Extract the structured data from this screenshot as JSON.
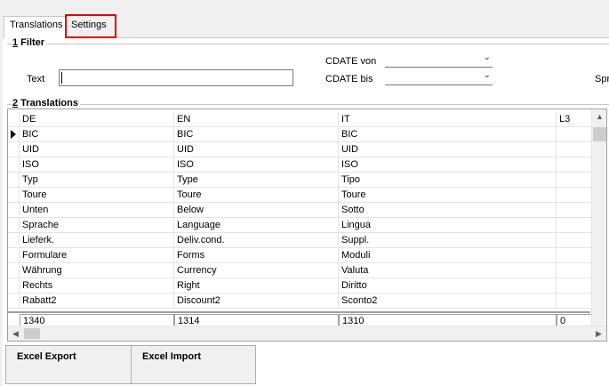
{
  "tabs": {
    "translations": "Translations",
    "settings": "Settings"
  },
  "filter": {
    "title_num": "1",
    "title_text": " Filter",
    "text_label": "Text",
    "text_value": "",
    "cdate_von_label": "CDATE von",
    "cdate_bis_label": "CDATE bis",
    "cdate_von_value": "",
    "cdate_bis_value": "",
    "spr_label": "Spr"
  },
  "translations": {
    "title_num": "2",
    "title_text": " Translations",
    "columns": [
      "DE",
      "EN",
      "IT",
      "L3"
    ],
    "rows": [
      [
        "BIC",
        "BIC",
        "BIC",
        ""
      ],
      [
        "UID",
        "UID",
        "UID",
        ""
      ],
      [
        "ISO",
        "ISO",
        "ISO",
        ""
      ],
      [
        "Typ",
        "Type",
        "Tipo",
        ""
      ],
      [
        "Toure",
        "Toure",
        "Toure",
        ""
      ],
      [
        "Unten",
        "Below",
        "Sotto",
        ""
      ],
      [
        "Sprache",
        "Language",
        "Lingua",
        ""
      ],
      [
        "Lieferk.",
        "Deliv.cond.",
        "Suppl.",
        ""
      ],
      [
        "Formulare",
        "Forms",
        "Moduli",
        ""
      ],
      [
        "Währung",
        "Currency",
        "Valuta",
        ""
      ],
      [
        "Rechts",
        "Right",
        "Diritto",
        ""
      ],
      [
        "Rabatt2",
        "Discount2",
        "Sconto2",
        ""
      ]
    ],
    "totals": [
      "1340",
      "1314",
      "1310",
      "0"
    ]
  },
  "buttons": {
    "excel_export": "Excel Export",
    "excel_import": "Excel Import"
  },
  "icons": {
    "dropdown": "chevron-down-icon",
    "current_row": "row-pointer-icon"
  },
  "colors": {
    "highlight_border": "#e00000",
    "background": "#f0f0f0"
  }
}
